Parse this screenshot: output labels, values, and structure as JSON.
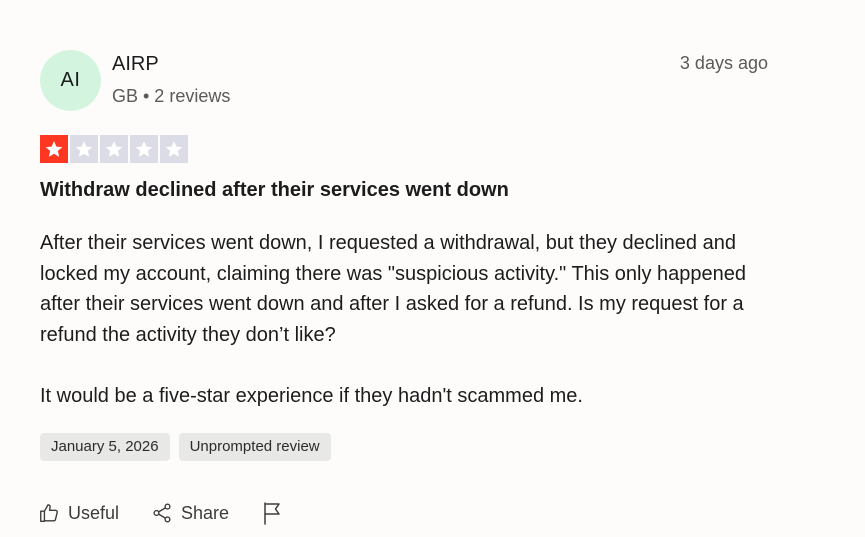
{
  "reviewer": {
    "initials": "AI",
    "name": "AIRP",
    "meta": "GB • 2 reviews"
  },
  "review": {
    "relative_date": "3 days ago",
    "rating": 1,
    "max_rating": 5,
    "star_color": "#ff3722",
    "empty_star_color": "#dcdce6",
    "title": "Withdraw declined after their services went down",
    "paragraphs": [
      "After their services went down, I requested a withdrawal, but they declined and locked my account, claiming there was \"suspicious activity.\" This only happened after their services went down and after I asked for a refund. Is my request for a refund the activity they don’t like?",
      "It would be a five-star experience if they hadn't scammed me."
    ],
    "tags": {
      "date": "January 5, 2026",
      "type": "Unprompted review"
    }
  },
  "actions": {
    "useful_label": "Useful",
    "share_label": "Share",
    "useful_icon": "thumbs-up-icon",
    "share_icon": "share-icon",
    "report_icon": "flag-icon"
  }
}
